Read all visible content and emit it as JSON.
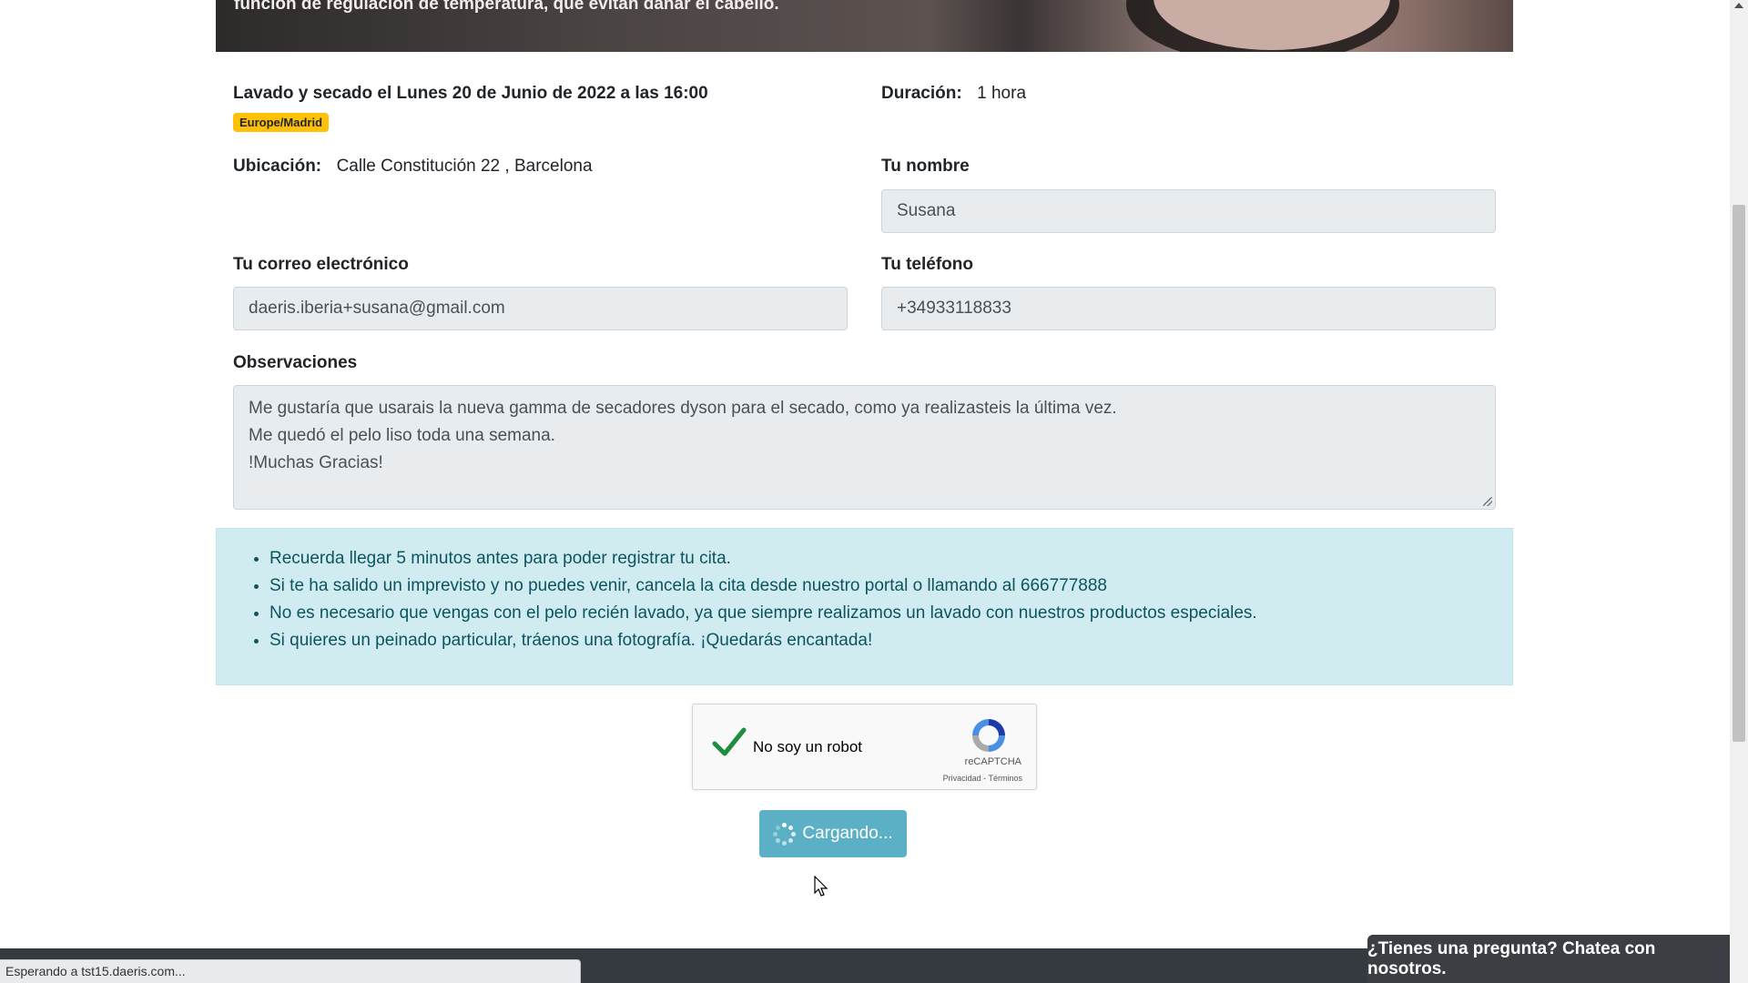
{
  "hero": {
    "caption": "función de regulación de temperatura, que evitan dañar el cabello."
  },
  "appointment": {
    "title": "Lavado y secado el Lunes 20 de Junio de 2022 a las 16:00",
    "timezone": "Europe/Madrid",
    "duration_label": "Duración:",
    "duration_value": "1 hora",
    "location_label": "Ubicación:",
    "location_value": "Calle Constitución 22 , Barcelona"
  },
  "form": {
    "name_label": "Tu nombre",
    "name_value": "Susana",
    "email_label": "Tu correo electrónico",
    "email_value": "daeris.iberia+susana@gmail.com",
    "phone_label": "Tu teléfono",
    "phone_value": "+34933118833",
    "notes_label": "Observaciones",
    "notes_lines": [
      "Me gustaría que usarais la nueva gamma de secadores dyson para el secado, como ya realizasteis la última vez.",
      "Me quedó el pelo liso toda una semana.",
      "!Muchas Gracias!"
    ]
  },
  "info": {
    "items": [
      "Recuerda llegar 5 minutos antes para poder registrar tu cita.",
      "Si te ha salido un imprevisto y no puedes venir, cancela la cita desde nuestro portal o llamando al 666777888",
      "No es necesario que vengas con el pelo recién lavado, ya que siempre realizamos un lavado con nuestros productos especiales.",
      "Si quieres un peinado particular, tráenos una fotografía. ¡Quedarás encantada!"
    ]
  },
  "captcha": {
    "label": "No soy un robot",
    "brand": "reCAPTCHA",
    "privacy": "Privacidad",
    "separator": " - ",
    "terms": "Términos",
    "checked": true,
    "check_color": "#1e8e3e"
  },
  "submit": {
    "label": "Cargando...",
    "color": "#5bb0c6"
  },
  "status_bar": {
    "text": "Esperando a tst15.daeris.com..."
  },
  "chat": {
    "label": "¿Tienes una pregunta? Chatea con nosotros."
  },
  "colors": {
    "badge": "#ffc107",
    "info_bg": "#d1ecf1",
    "info_text": "#0c5460",
    "footer": "#343a40"
  }
}
